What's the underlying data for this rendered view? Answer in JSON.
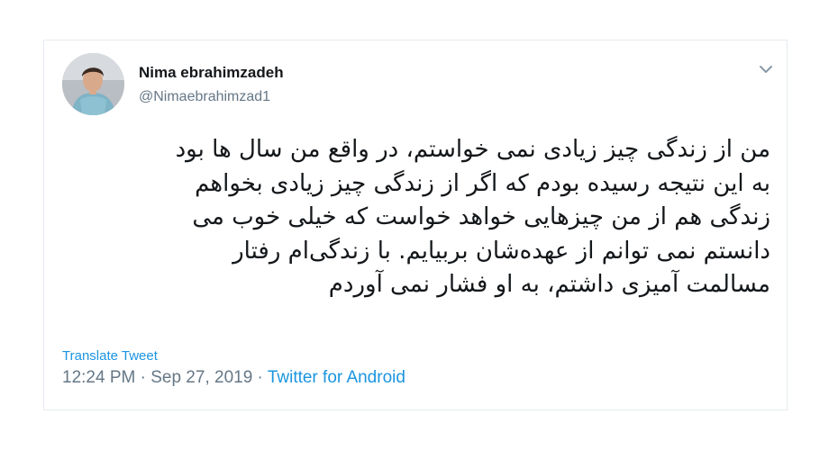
{
  "tweet": {
    "author_name": "Nima ebrahimzadeh",
    "author_handle": "@Nimaebrahimzad1",
    "lines": [
      "من از زندگی چیز زیادی نمی خواستم، در واقع من سال ها بود",
      "به این نتیجه رسیده بودم  که اگر از زندگی چیز زیادی بخواهم",
      "زندگی هم از من چیزهایی خواهد خواست که خیلی خوب می",
      "دانستم نمی توانم از عهده‌شان بربیایم. با زندگی‌ام رفتار",
      "مسالمت آمیزی داشتم، به او فشار نمی آوردم"
    ],
    "translate_label": "Translate Tweet",
    "time": "12:24 PM",
    "date": "Sep 27, 2019",
    "separator": "·",
    "source": "Twitter for Android"
  },
  "icons": {
    "menu": "chevron-down-icon",
    "avatar": "profile-photo"
  },
  "colors": {
    "link": "#1b95e0",
    "secondary_text": "#657786",
    "text": "#14171a",
    "border": "#e6ecf0"
  }
}
